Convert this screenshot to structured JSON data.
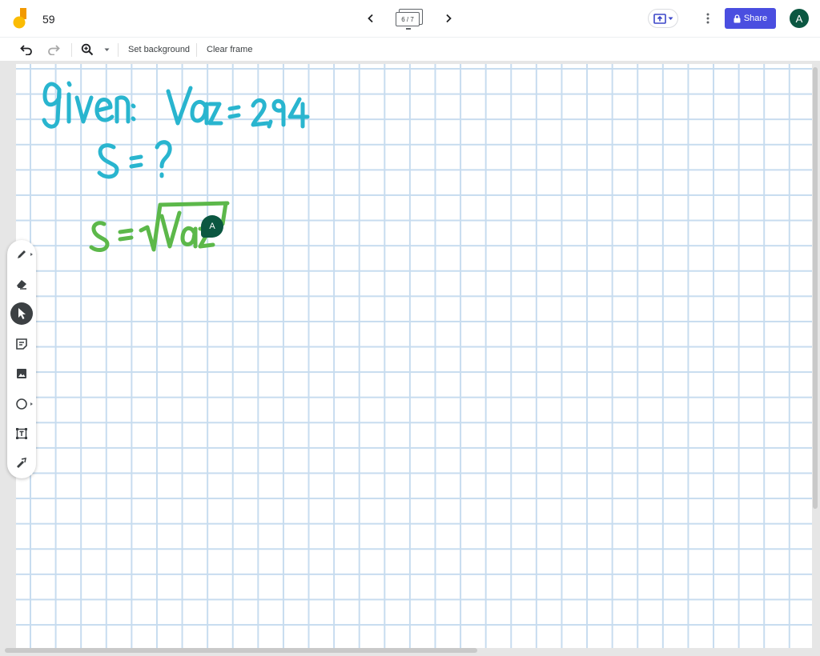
{
  "header": {
    "doc_title": "59",
    "frame_counter": "6 / 7",
    "share_label": "Share",
    "avatar_initial": "A"
  },
  "toolbar": {
    "set_background_label": "Set background",
    "clear_frame_label": "Clear frame"
  },
  "tools": [
    {
      "name": "pen",
      "icon": "pen-icon",
      "active": false
    },
    {
      "name": "eraser",
      "icon": "eraser-icon",
      "active": false
    },
    {
      "name": "select",
      "icon": "cursor-icon",
      "active": true
    },
    {
      "name": "sticky-note",
      "icon": "sticky-note-icon",
      "active": false
    },
    {
      "name": "image",
      "icon": "image-icon",
      "active": false
    },
    {
      "name": "circle",
      "icon": "circle-icon",
      "active": false
    },
    {
      "name": "text-box",
      "icon": "text-box-icon",
      "active": false
    },
    {
      "name": "laser",
      "icon": "laser-icon",
      "active": false
    }
  ],
  "collaborator": {
    "initial": "A"
  },
  "colors": {
    "brand_button": "#4a4ee0",
    "avatar": "#0b5741",
    "grid": "#c7dcef",
    "ink_blue": "#29b5cf",
    "ink_green": "#5cb84a"
  }
}
